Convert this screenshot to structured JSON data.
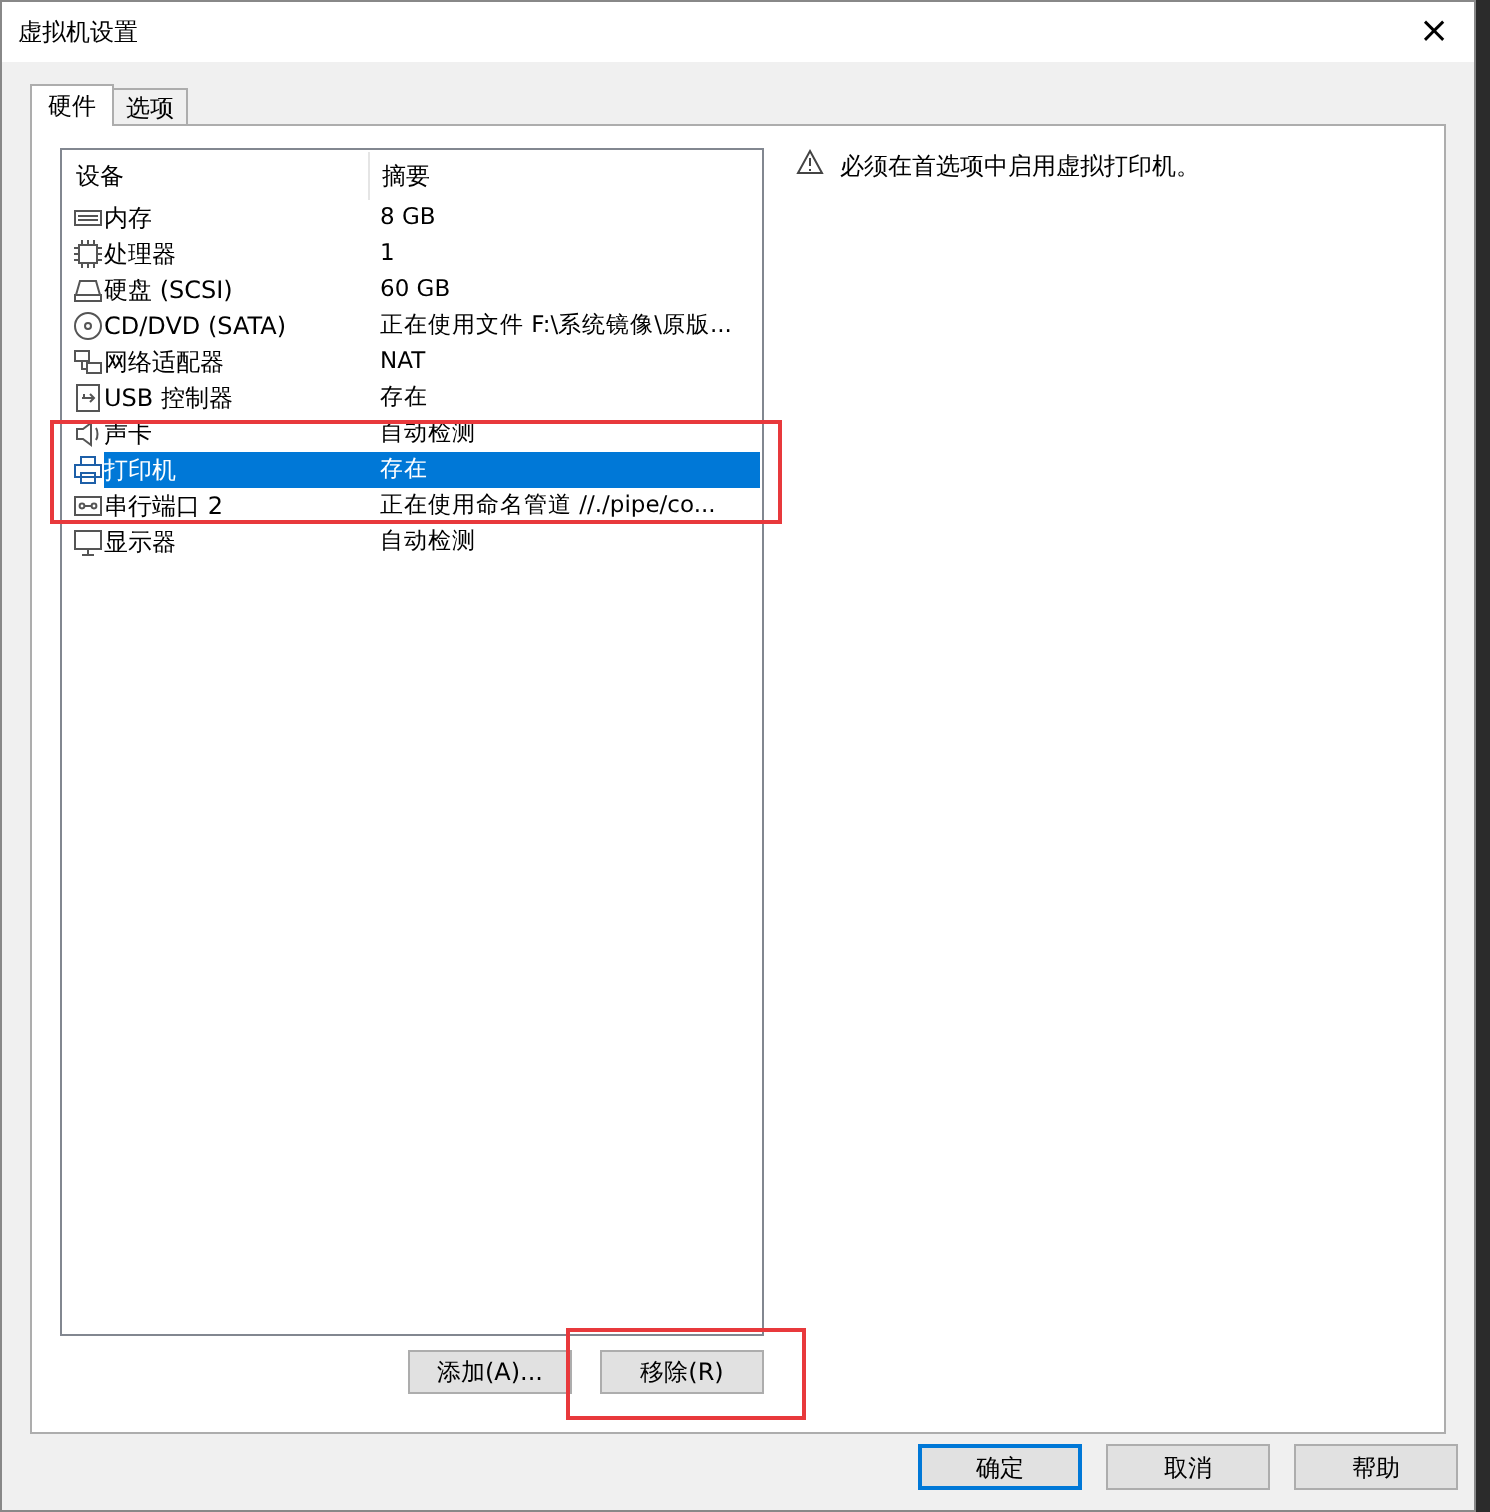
{
  "window": {
    "title": "虚拟机设置",
    "close": "×"
  },
  "tabs": [
    {
      "label": "硬件",
      "selected": true
    },
    {
      "label": "选项",
      "selected": false
    }
  ],
  "device_table": {
    "columns": [
      "设备",
      "摘要"
    ],
    "rows": [
      {
        "kind": "memory",
        "device": "内存",
        "summary": "8 GB",
        "selected": false
      },
      {
        "kind": "cpu",
        "device": "处理器",
        "summary": "1",
        "selected": false
      },
      {
        "kind": "disk",
        "device": "硬盘 (SCSI)",
        "summary": "60 GB",
        "selected": false
      },
      {
        "kind": "cd",
        "device": "CD/DVD (SATA)",
        "summary": "正在使用文件 F:\\系统镜像\\原版...",
        "selected": false
      },
      {
        "kind": "network",
        "device": "网络适配器",
        "summary": "NAT",
        "selected": false
      },
      {
        "kind": "usb",
        "device": "USB 控制器",
        "summary": "存在",
        "selected": false
      },
      {
        "kind": "sound",
        "device": "声卡",
        "summary": "自动检测",
        "selected": false
      },
      {
        "kind": "printer",
        "device": "打印机",
        "summary": "存在",
        "selected": true
      },
      {
        "kind": "serial",
        "device": "串行端口 2",
        "summary": "正在使用命名管道 //./pipe/co...",
        "selected": false
      },
      {
        "kind": "display",
        "device": "显示器",
        "summary": "自动检测",
        "selected": false
      }
    ]
  },
  "notice": "必须在首选项中启用虚拟打印机。",
  "list_buttons": [
    "添加(A)...",
    "移除(R)"
  ],
  "dialog_buttons": [
    {
      "label": "确定",
      "default": true
    },
    {
      "label": "取消",
      "default": false
    },
    {
      "label": "帮助",
      "default": false
    }
  ]
}
